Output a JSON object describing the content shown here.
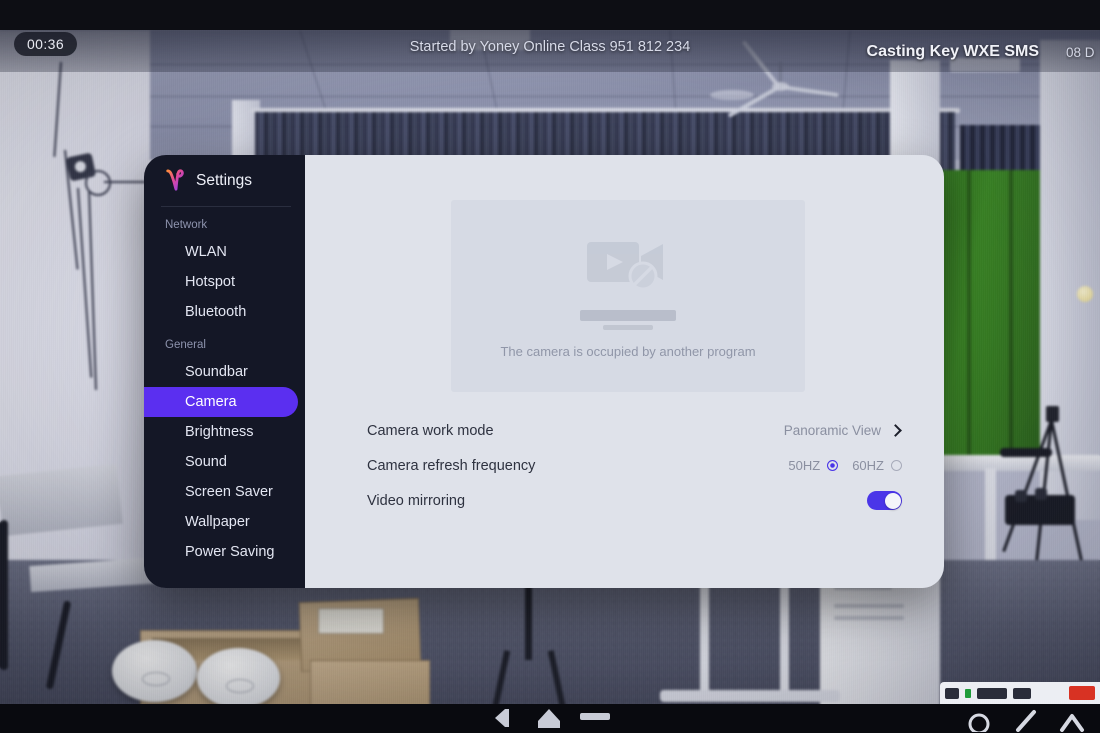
{
  "status_bar": {
    "timer": "00:36",
    "started_by": "Started by Yoney Online Class 951 812 234",
    "casting_key": "Casting Key WXE SMS",
    "date": "08 D"
  },
  "dialog": {
    "brand": {
      "title": "Settings",
      "logo_icon": "yealink-logo-icon"
    },
    "sidebar": {
      "groups": [
        {
          "label": "Network",
          "items": [
            {
              "label": "WLAN",
              "active": false
            },
            {
              "label": "Hotspot",
              "active": false
            },
            {
              "label": "Bluetooth",
              "active": false
            }
          ]
        },
        {
          "label": "General",
          "items": [
            {
              "label": "Soundbar",
              "active": false
            },
            {
              "label": "Camera",
              "active": true
            },
            {
              "label": "Brightness",
              "active": false
            },
            {
              "label": "Sound",
              "active": false
            },
            {
              "label": "Screen Saver",
              "active": false
            },
            {
              "label": "Wallpaper",
              "active": false
            },
            {
              "label": "Power Saving",
              "active": false
            }
          ]
        }
      ]
    },
    "preview": {
      "message": "The camera is occupied by another program",
      "icon": "camera-disabled-icon"
    },
    "rows": {
      "work_mode": {
        "label": "Camera work mode",
        "value": "Panoramic View",
        "chevron_icon": "chevron-right-icon"
      },
      "refresh_frequency": {
        "label": "Camera refresh frequency",
        "options": [
          {
            "label": "50HZ",
            "selected": true
          },
          {
            "label": "60HZ",
            "selected": false
          }
        ]
      },
      "video_mirroring": {
        "label": "Video mirroring",
        "enabled": true
      }
    }
  },
  "nav_bar": {
    "back_icon": "back-icon",
    "home_icon": "home-icon",
    "recents_icon": "recents-icon"
  },
  "colors": {
    "accent": "#5b2ff0",
    "toggle_on": "#4a35e8",
    "sidebar_bg": "#141726",
    "content_bg": "#dfe2ea"
  }
}
